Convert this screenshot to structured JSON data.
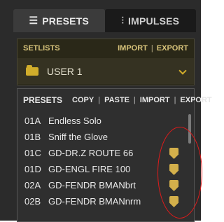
{
  "tabs": [
    {
      "label": "PRESETS",
      "icon": "list-icon",
      "active": true
    },
    {
      "label": "IMPULSES",
      "icon": "impulses-icon",
      "active": false
    }
  ],
  "setlists": {
    "title": "SETLISTS",
    "actions": [
      "IMPORT",
      "EXPORT"
    ],
    "selected": "USER 1",
    "colors": {
      "accent": "#d1ad2b",
      "text": "#d8c47b"
    }
  },
  "presets": {
    "title": "PRESETS",
    "actions": [
      "COPY",
      "PASTE",
      "IMPORT",
      "EXPORT"
    ],
    "items": [
      {
        "id": "01A",
        "name": "Endless Solo",
        "pinned": false
      },
      {
        "id": "01B",
        "name": "Sniff the Glove",
        "pinned": false
      },
      {
        "id": "01C",
        "name": "GD-DR.Z ROUTE 66",
        "pinned": true
      },
      {
        "id": "01D",
        "name": "GD-ENGL FIRE 100",
        "pinned": true
      },
      {
        "id": "02A",
        "name": "GD-FENDR BMANbrt",
        "pinned": true
      },
      {
        "id": "02B",
        "name": "GD-FENDR BMANnrm",
        "pinned": true
      }
    ],
    "pin_color": "#d4b04b"
  },
  "annotation": {
    "shape": "ellipse",
    "color": "#e11b1b"
  }
}
